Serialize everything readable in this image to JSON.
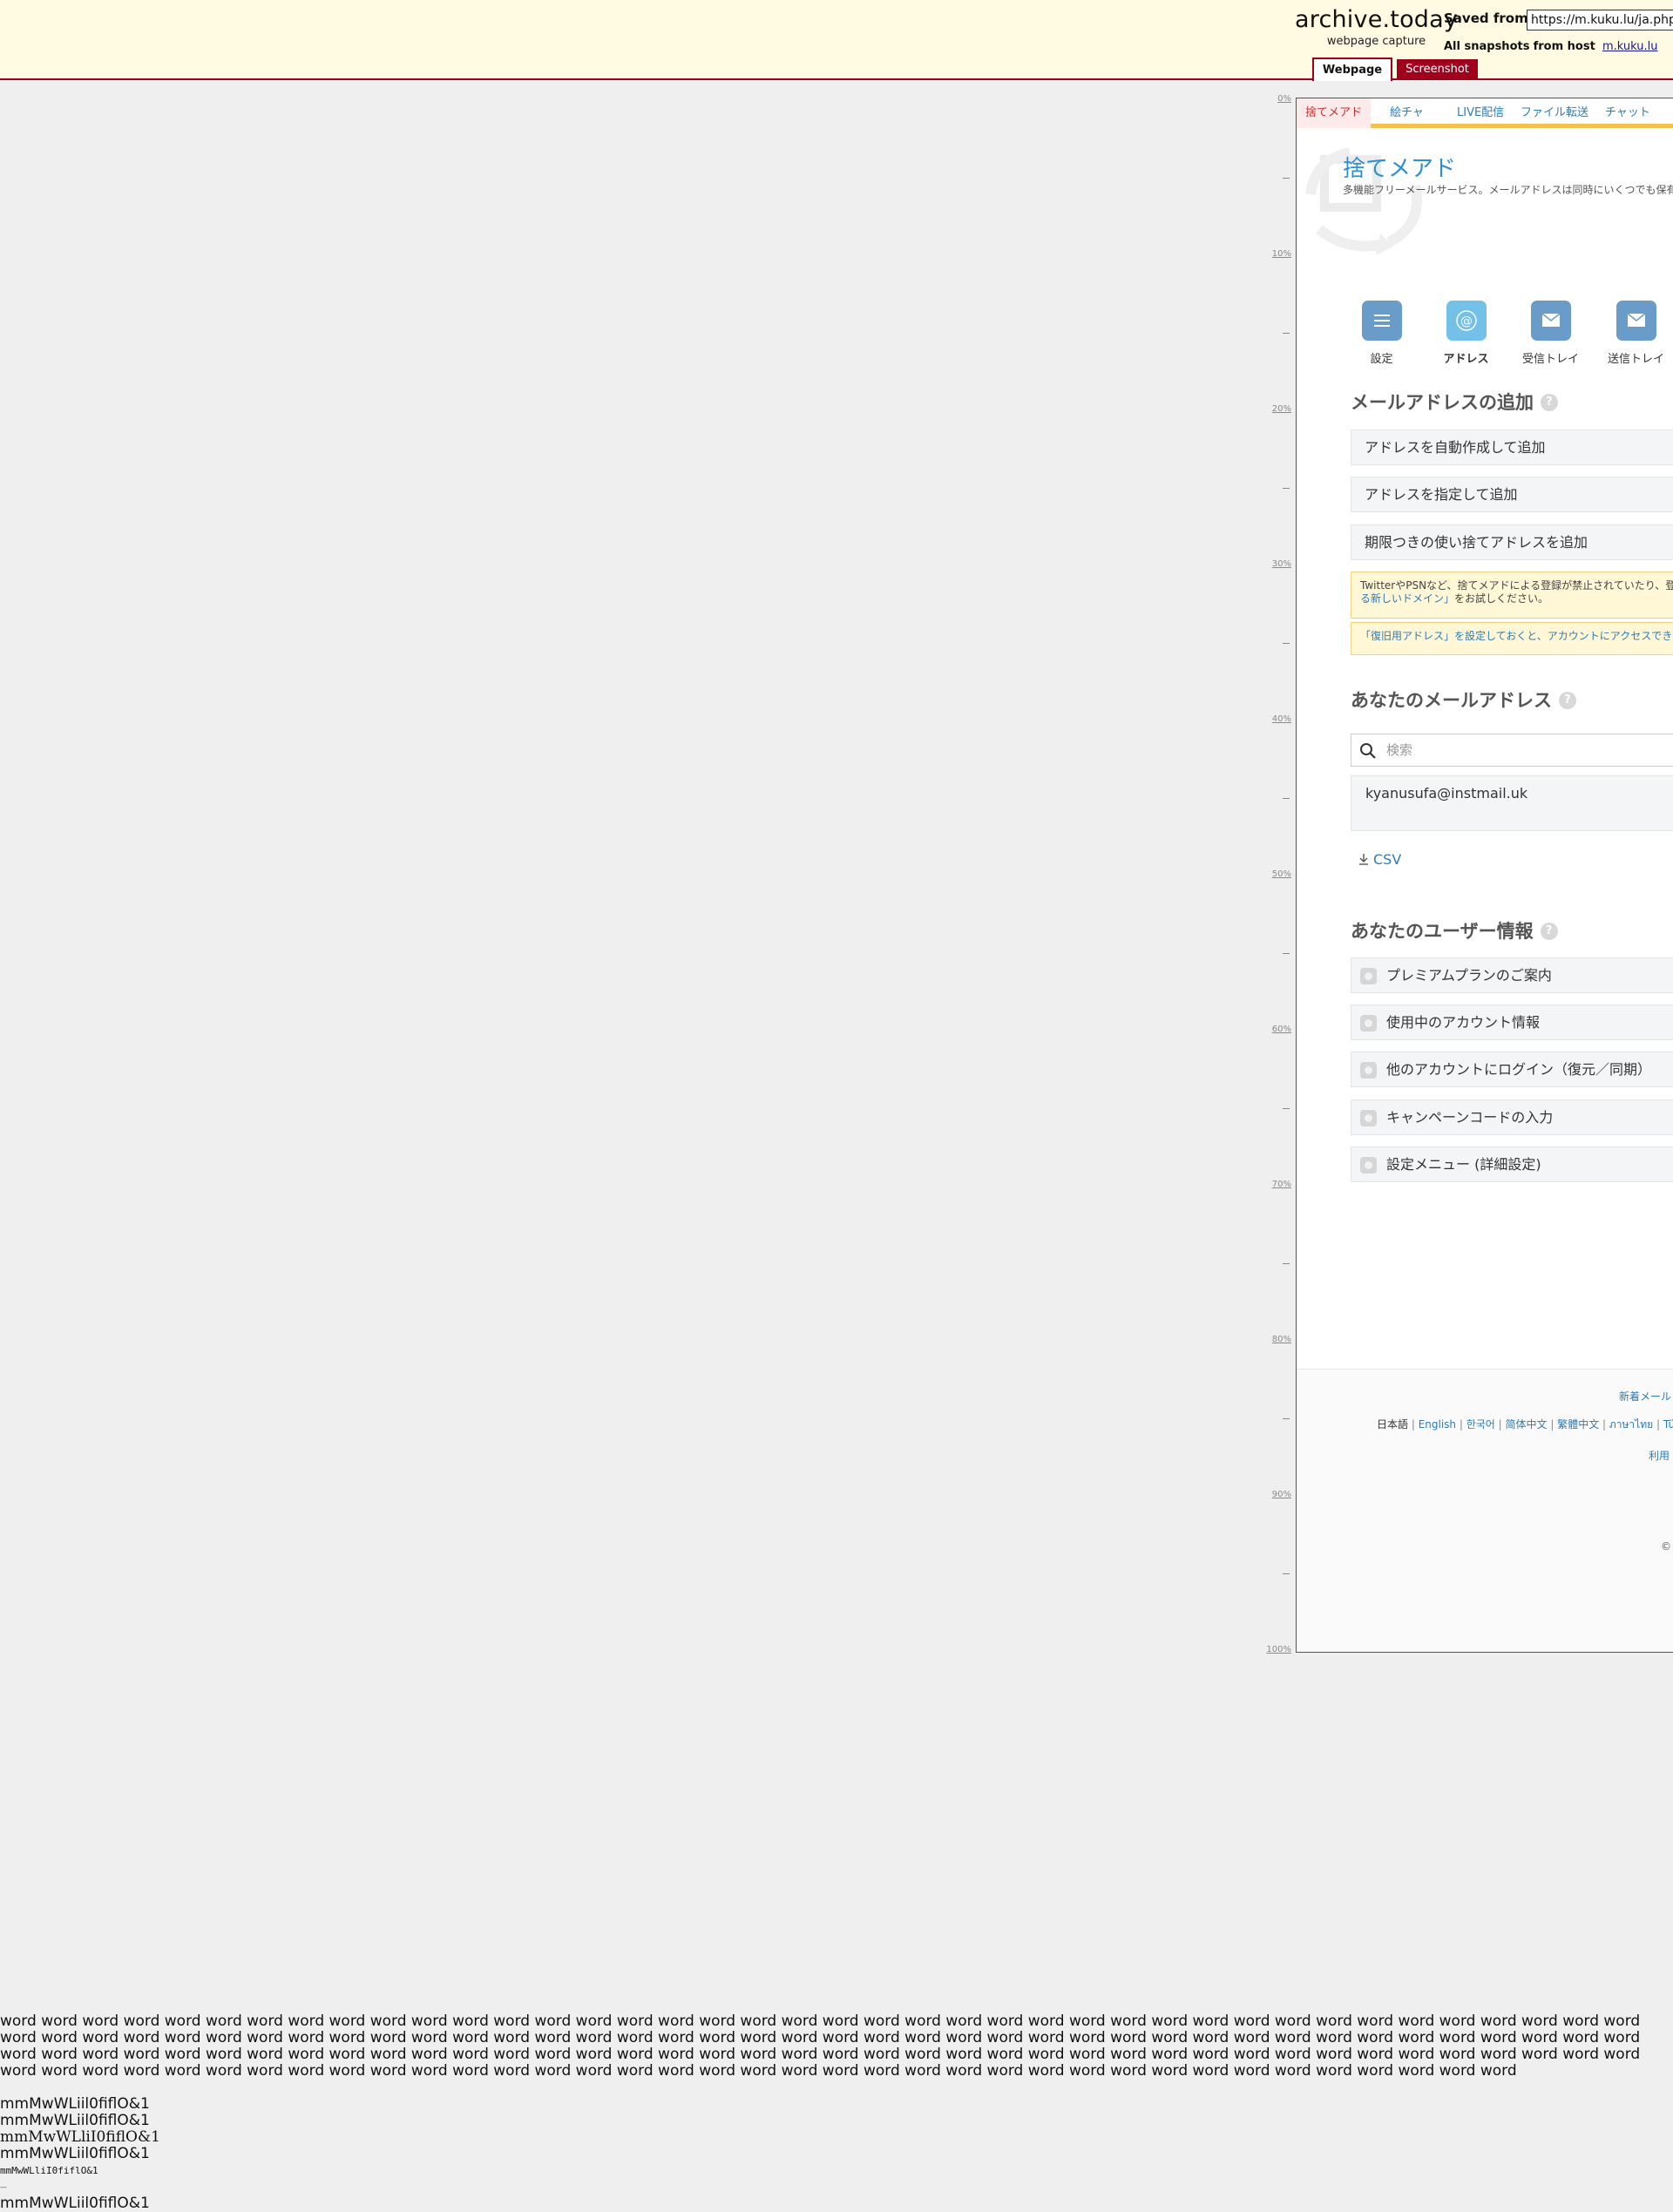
{
  "archive": {
    "logo_title": "archive.today",
    "logo_sub": "webpage capture",
    "saved_from_label": "Saved from",
    "saved_url": "https://m.kuku.lu/ja.php",
    "all_snapshots_label": "All snapshots",
    "from_host_label": "from host",
    "host_link": "m.kuku.lu",
    "tabs": {
      "webpage": "Webpage",
      "screenshot": "Screenshot"
    }
  },
  "scale": {
    "labels": [
      "0%",
      "10%",
      "20%",
      "30%",
      "40%",
      "50%",
      "60%",
      "70%",
      "80%",
      "90%",
      "100%"
    ]
  },
  "site": {
    "nav": [
      "捨てメアド",
      "絵チャ",
      "LIVE配信",
      "ファイル転送",
      "チャット"
    ],
    "title": "捨てメアド",
    "subtitle": "多機能フリーメールサービス。メールアドレスは同時にいくつでも保有",
    "icons": [
      {
        "label": "設定",
        "icon": "menu-icon",
        "color": "#6a9cc9"
      },
      {
        "label": "アドレス",
        "icon": "at-icon",
        "color": "#73c0e9"
      },
      {
        "label": "受信トレイ",
        "icon": "mail-icon",
        "color": "#6a9cc9"
      },
      {
        "label": "送信トレイ",
        "icon": "mail-icon",
        "color": "#6a9cc9"
      }
    ],
    "add_section": {
      "title": "メールアドレスの追加",
      "buttons": [
        "アドレスを自動作成して追加",
        "アドレスを指定して追加",
        "期限つきの使い捨てアドレスを追加"
      ],
      "notice1_a": "TwitterやPSNなど、捨てメアドによる登録が禁止されていたり、登",
      "notice1_b_link": "る新しいドメイン」",
      "notice1_b_rest": "をお試しください。",
      "notice2": "「復旧用アドレス」を設定しておくと、アカウントにアクセスでき"
    },
    "address_section": {
      "title": "あなたのメールアドレス",
      "search_placeholder": "検索",
      "addresses": [
        "kyanusufa@instmail.uk"
      ],
      "csv_label": "CSV"
    },
    "user_section": {
      "title": "あなたのユーザー情報",
      "items": [
        "プレミアムプランのご案内",
        "使用中のアカウント情報",
        "他のアカウントにログイン（復元／同期）",
        "キャンペーンコードの入力",
        "設定メニュー (詳細設定)"
      ]
    },
    "footer": {
      "new_mail": "新着メール",
      "langs": [
        "日本語",
        "English",
        "한국어",
        "简体中文",
        "繁體中文",
        "ภาษาไทย",
        "Türk"
      ],
      "terms": "利用",
      "copyright": "©"
    }
  },
  "test_text": {
    "word": "word",
    "word_count": 157,
    "glyph_lines": [
      "mmMwWLiil0fiflO&1",
      "mmMwWLiil0fiflO&1",
      "mmMwWLliI0fiflO&1",
      "mmMwWLiil0fiflO&1",
      "mmMwWLliI0fiflO&1",
      "mmMwWLiil0fiflO&1"
    ]
  }
}
